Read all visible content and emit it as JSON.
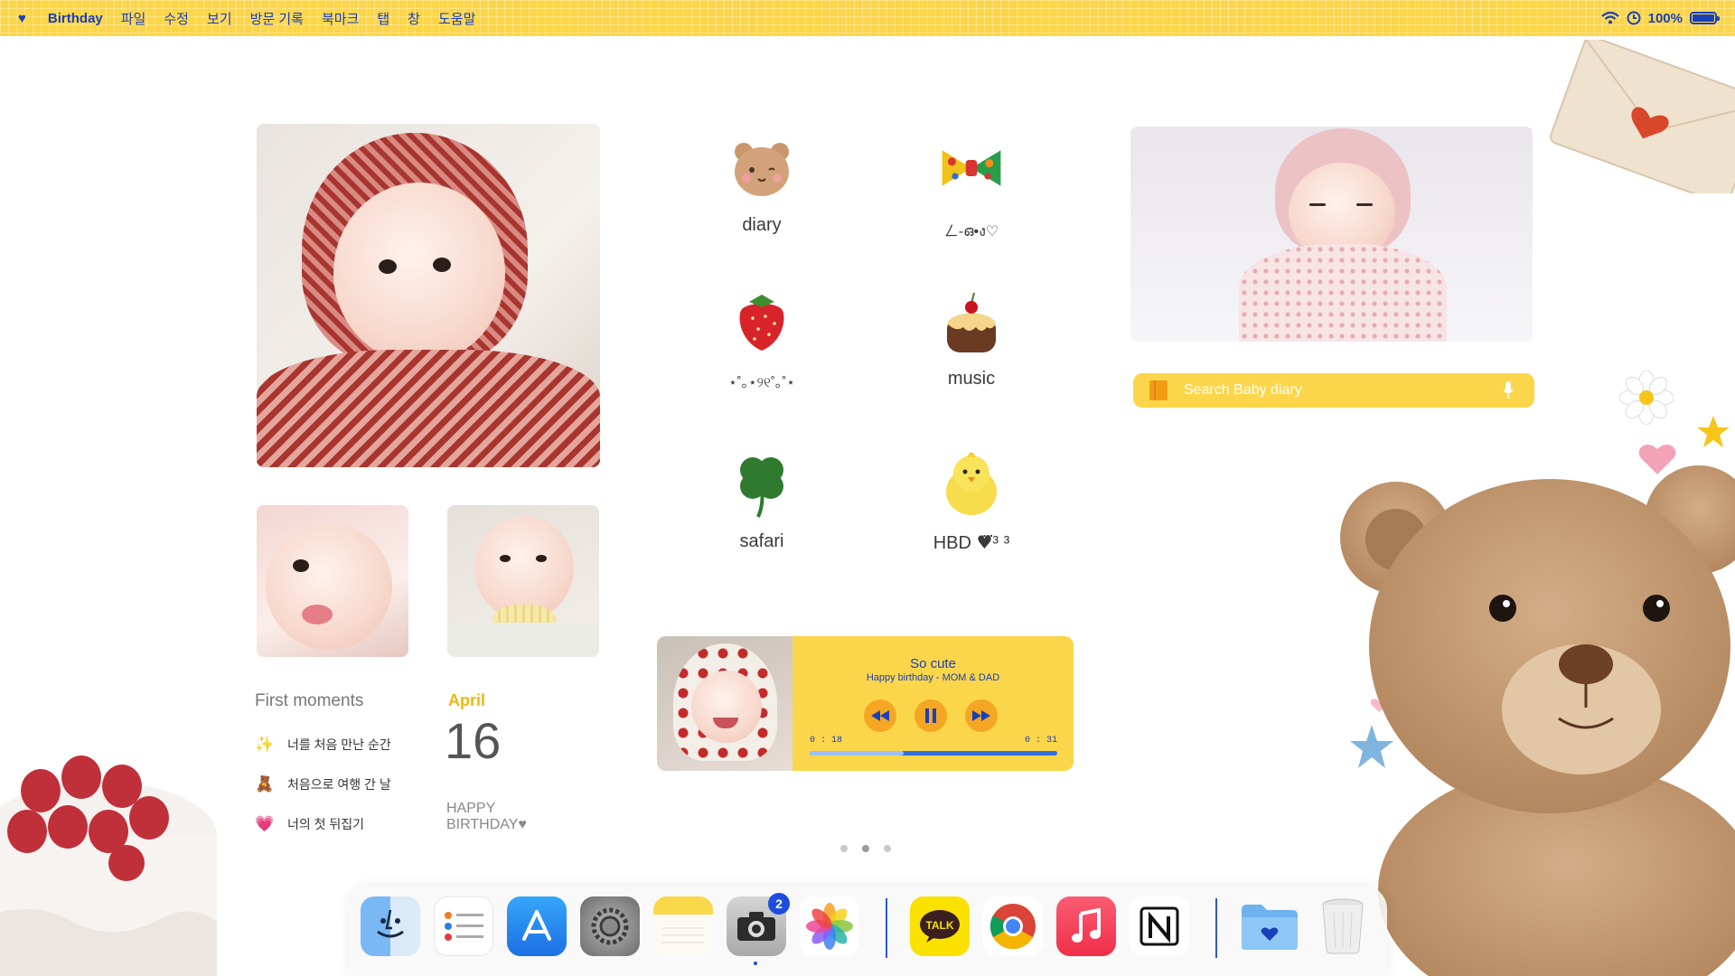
{
  "menubar": {
    "app_name": "Birthday",
    "items": [
      "파일",
      "수정",
      "보기",
      "방문 기록",
      "북마크",
      "탭",
      "창",
      "도움말"
    ],
    "battery": "100%"
  },
  "apps": [
    {
      "label": "diary",
      "icon": "bear-icon"
    },
    {
      "label": "ㄥ-ഒ•ง♡",
      "icon": "bow-icon"
    },
    {
      "label": "⋆˚｡⋆୨୧˚｡˚⋆",
      "icon": "strawberry-icon"
    },
    {
      "label": "music",
      "icon": "cake-icon"
    },
    {
      "label": "safari",
      "icon": "clover-icon"
    },
    {
      "label": "HBD ♥⃛³ ³",
      "icon": "chick-icon"
    }
  ],
  "search": {
    "placeholder": "Search Baby diary"
  },
  "moments": {
    "title": "First moments",
    "items": [
      {
        "emoji": "✨",
        "text": "너를 처음 만난 순간"
      },
      {
        "emoji": "🧸",
        "text": "처음으로 여행 간 날"
      },
      {
        "emoji": "💗",
        "text": "너의 첫 뒤집기"
      }
    ]
  },
  "date": {
    "month": "April",
    "day": "16",
    "note_line1": "HAPPY",
    "note_line2": "BIRTHDAY♥"
  },
  "music": {
    "title": "So cute",
    "subtitle": "Happy birthday - MOM & DAD",
    "elapsed": "0 : 18",
    "duration": "0 : 31",
    "progress": 0.38
  },
  "page_indicator": {
    "count": 3,
    "active": 1
  },
  "dock": {
    "camera_badge": "2",
    "apps": [
      "finder",
      "reminders",
      "app-store",
      "system-settings",
      "notes",
      "camera",
      "photos",
      "kakaotalk",
      "chrome",
      "music",
      "notion",
      "folder",
      "trash"
    ]
  },
  "colors": {
    "accent": "#fcd64a",
    "text_blue": "#1b3fb8",
    "orange": "#f5a623"
  }
}
